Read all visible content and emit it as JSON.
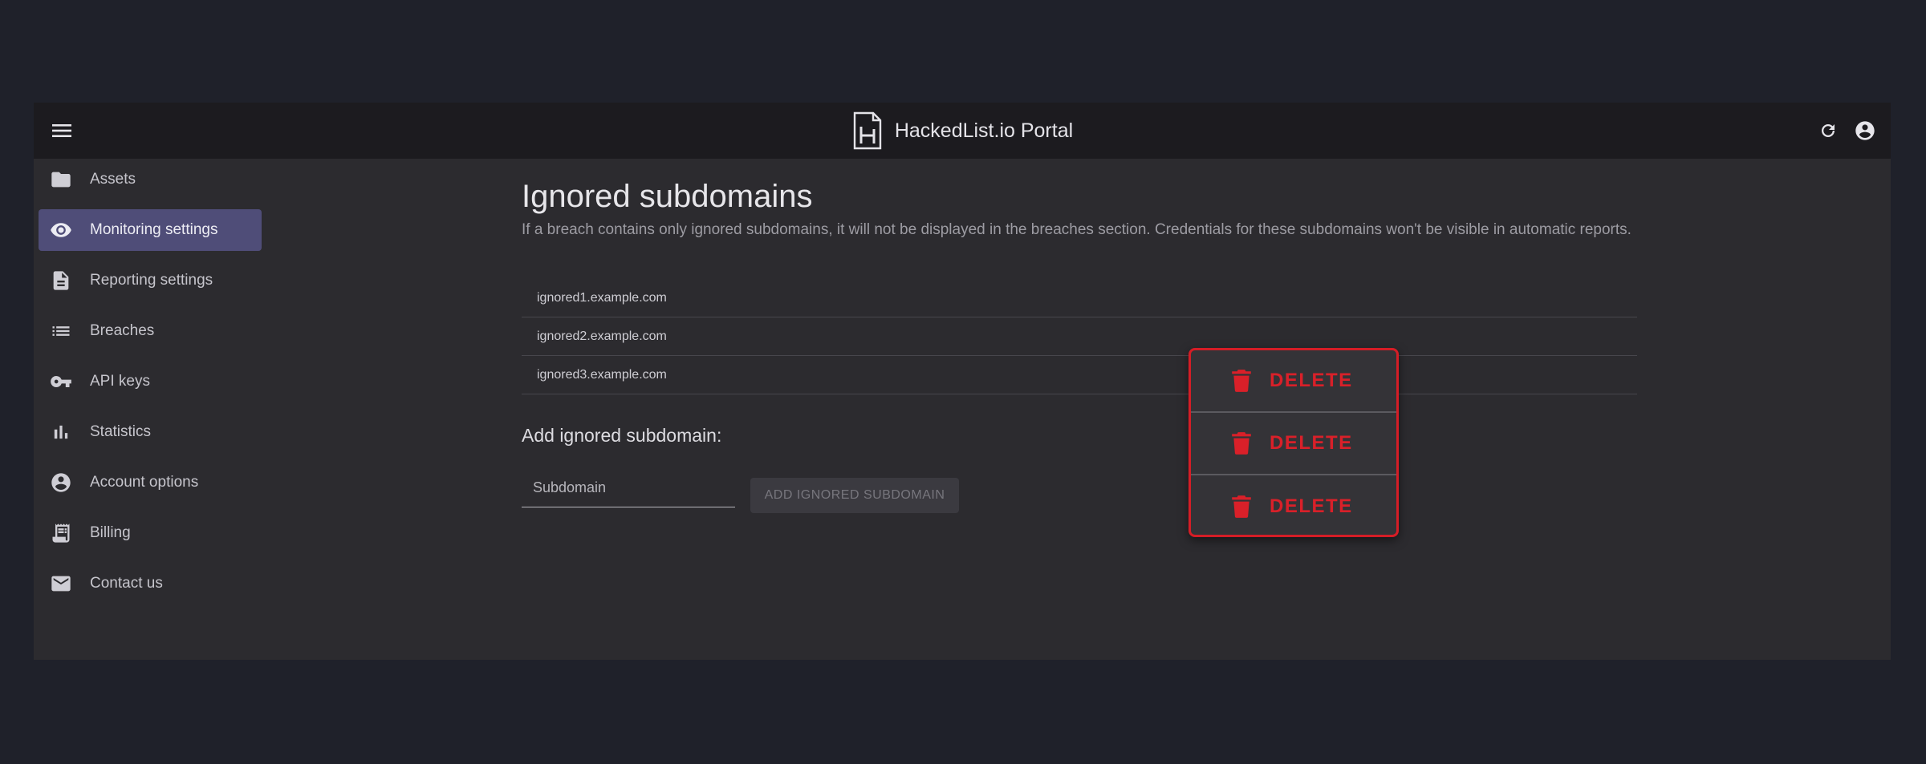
{
  "header": {
    "title": "HackedList.io Portal"
  },
  "sidebar": {
    "items": [
      {
        "label": "Assets",
        "icon": "folder-icon"
      },
      {
        "label": "Monitoring settings",
        "icon": "eye-icon",
        "active": true
      },
      {
        "label": "Reporting settings",
        "icon": "document-icon"
      },
      {
        "label": "Breaches",
        "icon": "list-icon"
      },
      {
        "label": "API keys",
        "icon": "key-icon"
      },
      {
        "label": "Statistics",
        "icon": "bar-chart-icon"
      },
      {
        "label": "Account options",
        "icon": "account-icon"
      },
      {
        "label": "Billing",
        "icon": "receipt-icon"
      },
      {
        "label": "Contact us",
        "icon": "mail-icon"
      }
    ]
  },
  "main": {
    "title": "Ignored subdomains",
    "description": "If a breach contains only ignored subdomains, it will not be displayed in the breaches section. Credentials for these subdomains won't be visible in automatic reports.",
    "subdomains": [
      "ignored1.example.com",
      "ignored2.example.com",
      "ignored3.example.com"
    ],
    "add_title": "Add ignored subdomain:",
    "input_placeholder": "Subdomain",
    "add_button": "ADD IGNORED SUBDOMAIN",
    "delete_label": "DELETE"
  },
  "colors": {
    "background": "#1f212a",
    "appbar": "#1c1b1f",
    "surface": "#2c2b2f",
    "active_nav": "#4f4d78",
    "danger": "#d51d26"
  }
}
